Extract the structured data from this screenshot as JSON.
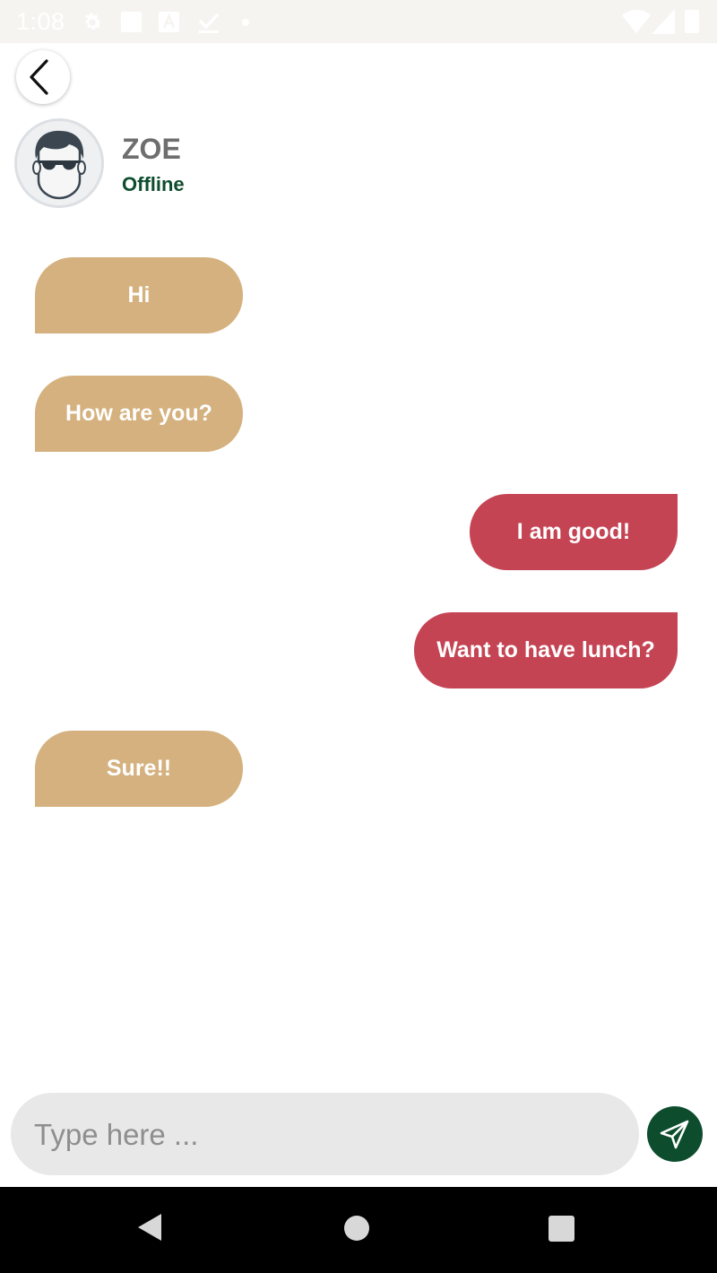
{
  "status_bar": {
    "time": "1:08",
    "icons": [
      "gear-icon",
      "square-icon",
      "font-icon",
      "download-check-icon",
      "dot-icon",
      "wifi-icon",
      "signal-icon",
      "battery-icon"
    ]
  },
  "header": {
    "back_icon": "chevron-left-icon",
    "contact": {
      "name": "ZOE",
      "status": "Offline",
      "avatar_icon": "avatar-sunglasses-icon"
    }
  },
  "messages": [
    {
      "direction": "incoming",
      "text": "Hi"
    },
    {
      "direction": "incoming",
      "text": "How are you?"
    },
    {
      "direction": "outgoing",
      "text": "I am good!"
    },
    {
      "direction": "outgoing",
      "text": "Want to have lunch?"
    },
    {
      "direction": "incoming",
      "text": "Sure!!"
    }
  ],
  "composer": {
    "value": "",
    "placeholder": "Type here ...",
    "send_icon": "send-icon"
  },
  "nav_bar": {
    "items": [
      "nav-back-icon",
      "nav-home-icon",
      "nav-recents-icon"
    ]
  },
  "colors": {
    "incoming_bubble": "#d4b17e",
    "outgoing_bubble": "#c54454",
    "accent_green": "#0d4d2e",
    "input_background": "#e8e8e8",
    "status_bar": "#f5f4f1"
  }
}
